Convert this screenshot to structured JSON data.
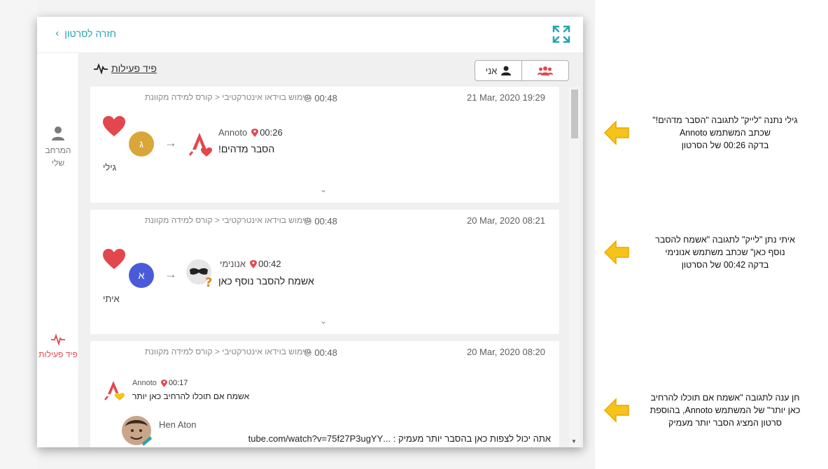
{
  "topbar": {
    "back_label": "חזרה לסרטון",
    "back_icon": "chevron-right-icon",
    "expand_icon": "expand-icon"
  },
  "sidebar": {
    "my_space_line1": "המרחב",
    "my_space_line2": "שלי",
    "feed_label": "פיד פעילות"
  },
  "feed": {
    "title": "פיד פעילות",
    "toggle_me": "אני",
    "toggle_group_icon": "group-icon",
    "cards": [
      {
        "date": "21 Mar, 2020 19:29",
        "time": "00:48",
        "course": "שימוש בוידאו אינטרקטיבי < קורס למידה מקוונת",
        "actor_initial": "ג",
        "actor_name": "גילי",
        "comment_author": "Annoto",
        "comment_time": "00:26",
        "comment_text": "הסבר מדהים!"
      },
      {
        "date": "20 Mar, 2020 08:21",
        "time": "00:48",
        "course": "שימוש בוידאו אינטרקטיבי < קורס למידה מקוונת",
        "actor_initial": "א",
        "actor_name": "איתי",
        "comment_author": "אנונימי",
        "comment_time": "00:42",
        "comment_text": "אשמח להסבר נוסף כאן"
      },
      {
        "date": "20 Mar, 2020 08:20",
        "time": "00:48",
        "course": "שימוש בוידאו אינטרקטיבי < קורס למידה מקוונת",
        "comment_author": "Annoto",
        "comment_time": "00:17",
        "comment_text": "אשמח אם תוכלו להרחיב כאן יותר",
        "reply_author": "Hen Aton",
        "reply_text": "אתה יכול לצפות כאן בהסבר יותר מעמיק : ...tube.com/watch?v=75f27P3ugYY"
      }
    ]
  },
  "annotations": [
    {
      "line1": "גילי נתנה \"לייק\" לתגובה \"הסבר מדהים!\"",
      "line2": "שכתב המשתמש Annoto",
      "line3": "בדקה 00:26 של הסרטון"
    },
    {
      "line1": "איתי נתן \"לייק\" לתגובה \"אשמח להסבר",
      "line2": "נוסף כאן\" שכתב משתמש אנונימי",
      "line3": "בדקה 00:42 של הסרטון"
    },
    {
      "line1": "חן ענה לתגובה \"אשמח אם תוכלו להרחיב",
      "line2": "כאן יותר\" של המשתמש Annoto,  בהוספת",
      "line3": "סרטון המציג הסבר יותר מעמיק"
    }
  ],
  "colors": {
    "accent_teal": "#27a3b0",
    "heart_red": "#e2474d",
    "annoto_red": "#e2474d",
    "avatar_gold": "#d9a63a",
    "avatar_blue": "#4a5bd9",
    "annotation_yellow": "#f6c31b"
  }
}
